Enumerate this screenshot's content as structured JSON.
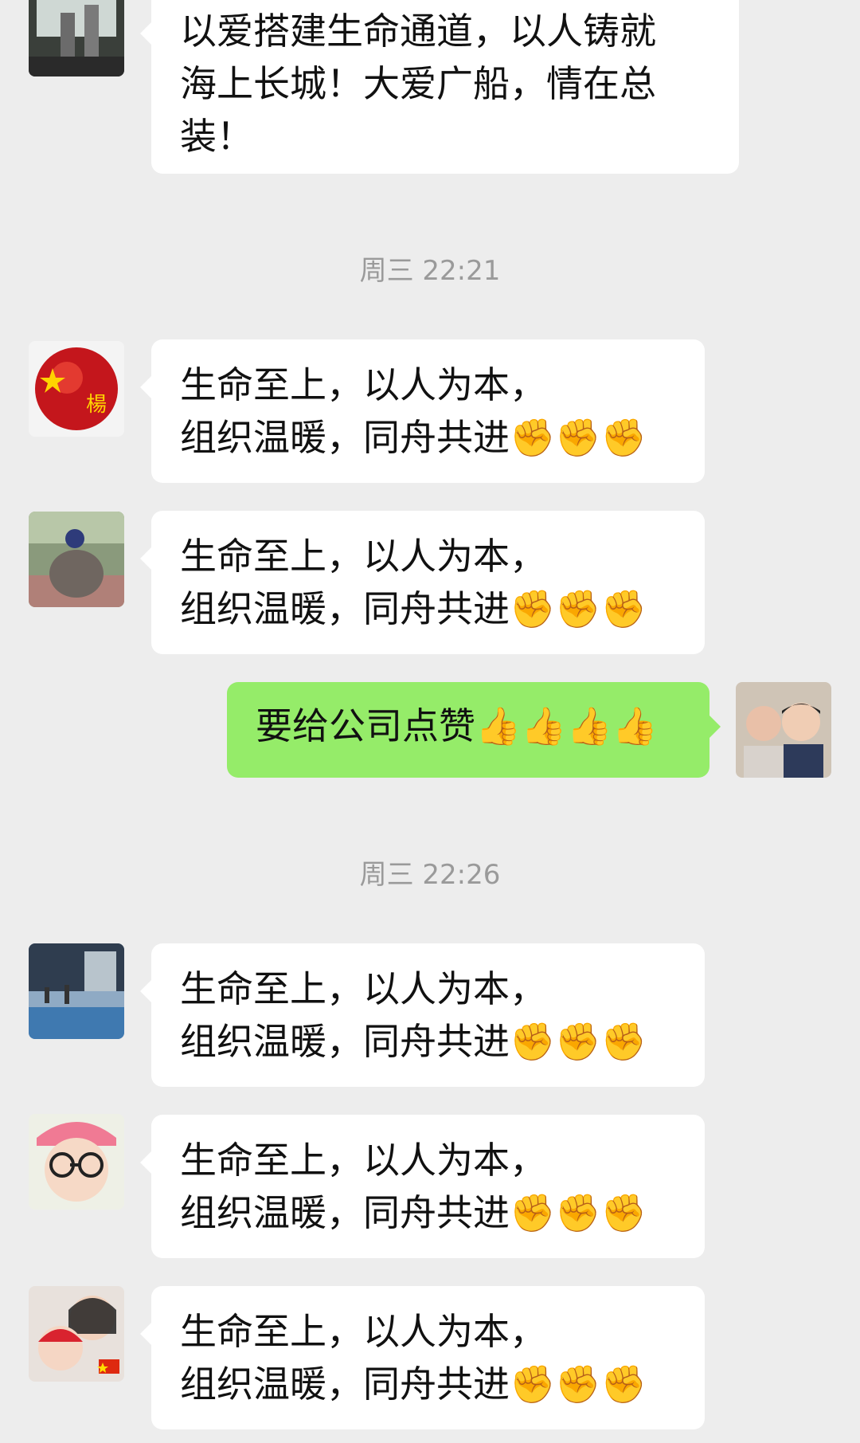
{
  "messages": [
    {
      "lines": [
        "以爱搭建生命通道，以人铸就",
        "海上长城！大爱广船，情在总",
        "装！"
      ]
    },
    {
      "lines": [
        "生命至上，以人为本，",
        "组织温暖，同舟共进✊✊✊"
      ]
    },
    {
      "lines": [
        "生命至上，以人为本，",
        "组织温暖，同舟共进✊✊✊"
      ]
    },
    {
      "lines": [
        "要给公司点赞👍👍👍👍"
      ]
    },
    {
      "lines": [
        "生命至上，以人为本，",
        "组织温暖，同舟共进✊✊✊"
      ]
    },
    {
      "lines": [
        "生命至上，以人为本，",
        "组织温暖，同舟共进✊✊✊"
      ]
    },
    {
      "lines": [
        "生命至上，以人为本，",
        "组织温暖，同舟共进✊✊✊"
      ]
    }
  ],
  "timestamps": [
    "周三 22:21",
    "周三 22:26"
  ],
  "colors": {
    "background": "#ededed",
    "bubble_in": "#ffffff",
    "bubble_out": "#95ec69",
    "timestamp": "#9a9a9a"
  }
}
